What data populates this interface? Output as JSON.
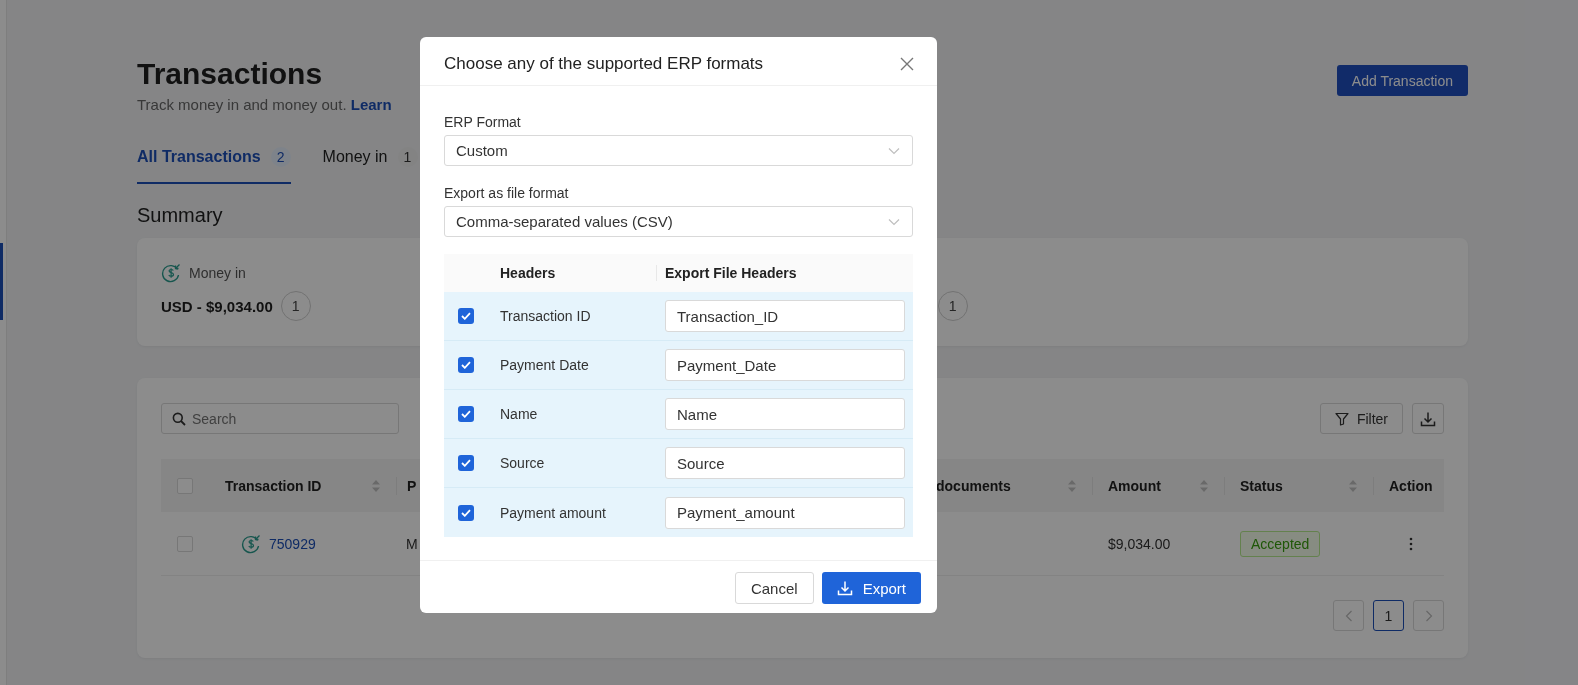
{
  "page": {
    "title": "Transactions",
    "subtitle": "Track money in and money out.",
    "learn_link": "Learn",
    "add_button": "Add Transaction",
    "tabs": [
      {
        "label": "All Transactions",
        "count": "2",
        "selected": true
      },
      {
        "label": "Money in",
        "count": "1",
        "selected": false
      }
    ],
    "summary": {
      "title": "Summary",
      "items": [
        {
          "label": "Money in",
          "amount": "USD - $9,034.00",
          "count": "1"
        },
        {
          "count": "1"
        }
      ]
    },
    "toolbar": {
      "search_placeholder": "Search",
      "filter": "Filter"
    },
    "table": {
      "select_all_checked": false,
      "columns": [
        {
          "label": "Transaction ID",
          "sortable": true
        },
        {
          "label": "P",
          "sortable": false
        },
        {
          "label": "documents",
          "sortable": true
        },
        {
          "label": "Amount",
          "sortable": true
        },
        {
          "label": "Status",
          "sortable": true
        },
        {
          "label": "Action",
          "sortable": false
        }
      ],
      "rows": [
        {
          "checked": false,
          "transaction_id": "750929",
          "column_2": "M",
          "amount": "$9,034.00",
          "status": "Accepted"
        }
      ]
    },
    "pagination": {
      "pages": [
        {
          "label": "1",
          "selected": true
        }
      ]
    }
  },
  "dialog": {
    "title": "Choose any of the supported ERP formats",
    "fields": [
      {
        "label": "ERP Format",
        "value": "Custom"
      },
      {
        "label": "Export as file format",
        "value": "Comma-separated values (CSV)"
      }
    ],
    "mapping_columns": [
      "Headers",
      "Export File Headers"
    ],
    "mapping_rows": [
      {
        "checked": true,
        "header": "Transaction ID",
        "export_header": "Transaction_ID"
      },
      {
        "checked": true,
        "header": "Payment Date",
        "export_header": "Payment_Date"
      },
      {
        "checked": true,
        "header": "Name",
        "export_header": "Name"
      },
      {
        "checked": true,
        "header": "Source",
        "export_header": "Source"
      },
      {
        "checked": true,
        "header": "Payment amount",
        "export_header": "Payment_amount"
      }
    ],
    "cancel_button": "Cancel",
    "export_button": "Export"
  }
}
